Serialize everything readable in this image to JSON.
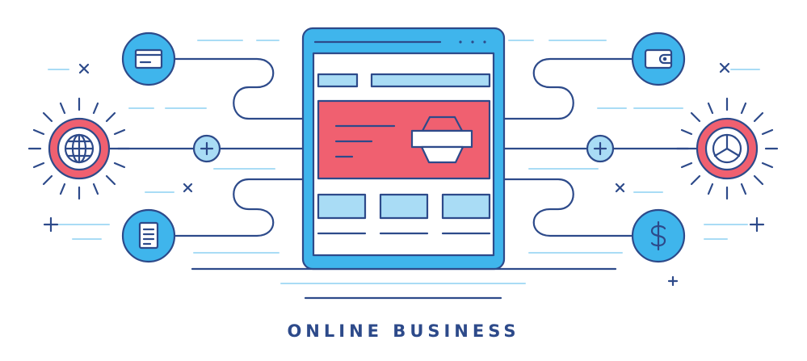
{
  "caption": "ONLINE BUSINESS",
  "colors": {
    "outline": "#2d4a8a",
    "accent_blue": "#3fb5ec",
    "pale_blue": "#a9dcf5",
    "accent_red": "#f06070",
    "background": "#ffffff"
  },
  "icons": [
    "credit-card-icon",
    "globe-icon",
    "plus-icon",
    "document-icon",
    "wallet-icon",
    "pie-chart-icon",
    "dollar-icon"
  ]
}
